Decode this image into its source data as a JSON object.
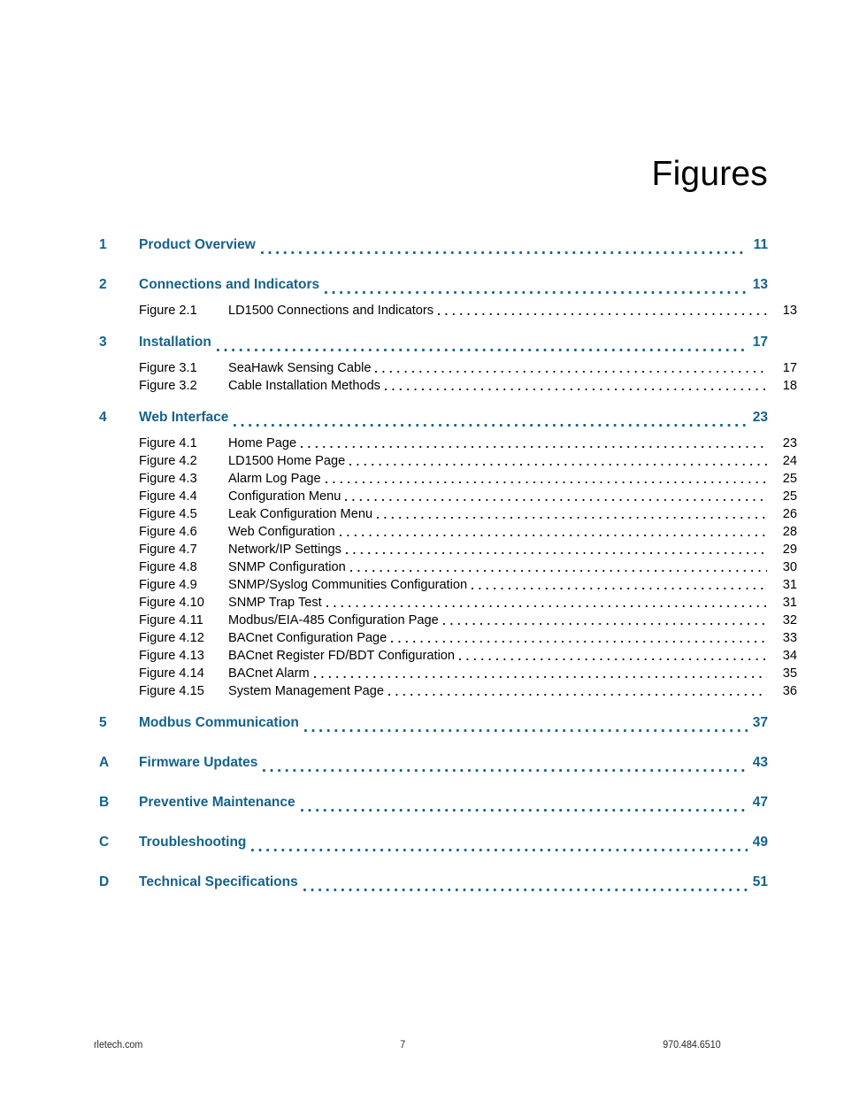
{
  "page": {
    "title": "Figures",
    "accent_color": "#15628b",
    "text_color": "#000000"
  },
  "toc": {
    "entries": [
      {
        "kind": "chapter",
        "number": "1",
        "title": "Product Overview",
        "page": "11",
        "figures": []
      },
      {
        "kind": "chapter",
        "number": "2",
        "title": "Connections and Indicators",
        "page": "13",
        "figures": [
          {
            "label": "Figure 2.1",
            "title": "LD1500 Connections and Indicators",
            "page": "13"
          }
        ]
      },
      {
        "kind": "chapter",
        "number": "3",
        "title": "Installation",
        "page": "17",
        "figures": [
          {
            "label": "Figure 3.1",
            "title": "SeaHawk Sensing Cable",
            "page": "17"
          },
          {
            "label": "Figure 3.2",
            "title": "Cable Installation Methods",
            "page": "18"
          }
        ]
      },
      {
        "kind": "chapter",
        "number": "4",
        "title": "Web Interface",
        "page": "23",
        "figures": [
          {
            "label": "Figure 4.1",
            "title": "Home Page",
            "page": "23"
          },
          {
            "label": "Figure 4.2",
            "title": "LD1500 Home Page",
            "page": "24"
          },
          {
            "label": "Figure 4.3",
            "title": "Alarm Log Page",
            "page": "25"
          },
          {
            "label": "Figure 4.4",
            "title": "Configuration Menu",
            "page": "25"
          },
          {
            "label": "Figure 4.5",
            "title": "Leak Configuration Menu",
            "page": "26"
          },
          {
            "label": "Figure 4.6",
            "title": "Web Configuration",
            "page": "28"
          },
          {
            "label": "Figure 4.7",
            "title": "Network/IP Settings",
            "page": "29"
          },
          {
            "label": "Figure 4.8",
            "title": "SNMP Configuration",
            "page": "30"
          },
          {
            "label": "Figure 4.9",
            "title": "SNMP/Syslog Communities Configuration",
            "page": "31"
          },
          {
            "label": "Figure 4.10",
            "title": "SNMP Trap Test",
            "page": "31"
          },
          {
            "label": "Figure 4.11",
            "title": "Modbus/EIA-485 Configuration Page",
            "page": "32"
          },
          {
            "label": "Figure 4.12",
            "title": "BACnet Configuration Page",
            "page": "33"
          },
          {
            "label": "Figure 4.13",
            "title": "BACnet Register FD/BDT Configuration",
            "page": "34"
          },
          {
            "label": "Figure 4.14",
            "title": "BACnet Alarm",
            "page": "35"
          },
          {
            "label": "Figure 4.15",
            "title": "System Management Page",
            "page": "36"
          }
        ]
      },
      {
        "kind": "chapter",
        "number": "5",
        "title": "Modbus Communication",
        "page": "37",
        "figures": []
      },
      {
        "kind": "appendix",
        "number": "A",
        "title": "Firmware Updates",
        "page": "43",
        "figures": []
      },
      {
        "kind": "appendix",
        "number": "B",
        "title": "Preventive Maintenance",
        "page": "47",
        "figures": []
      },
      {
        "kind": "appendix",
        "number": "C",
        "title": "Troubleshooting",
        "page": "49",
        "figures": []
      },
      {
        "kind": "appendix",
        "number": "D",
        "title": "Technical Specifications",
        "page": "51",
        "figures": []
      }
    ]
  },
  "footer": {
    "left": "rletech.com",
    "center": "7",
    "right": "970.484.6510"
  }
}
